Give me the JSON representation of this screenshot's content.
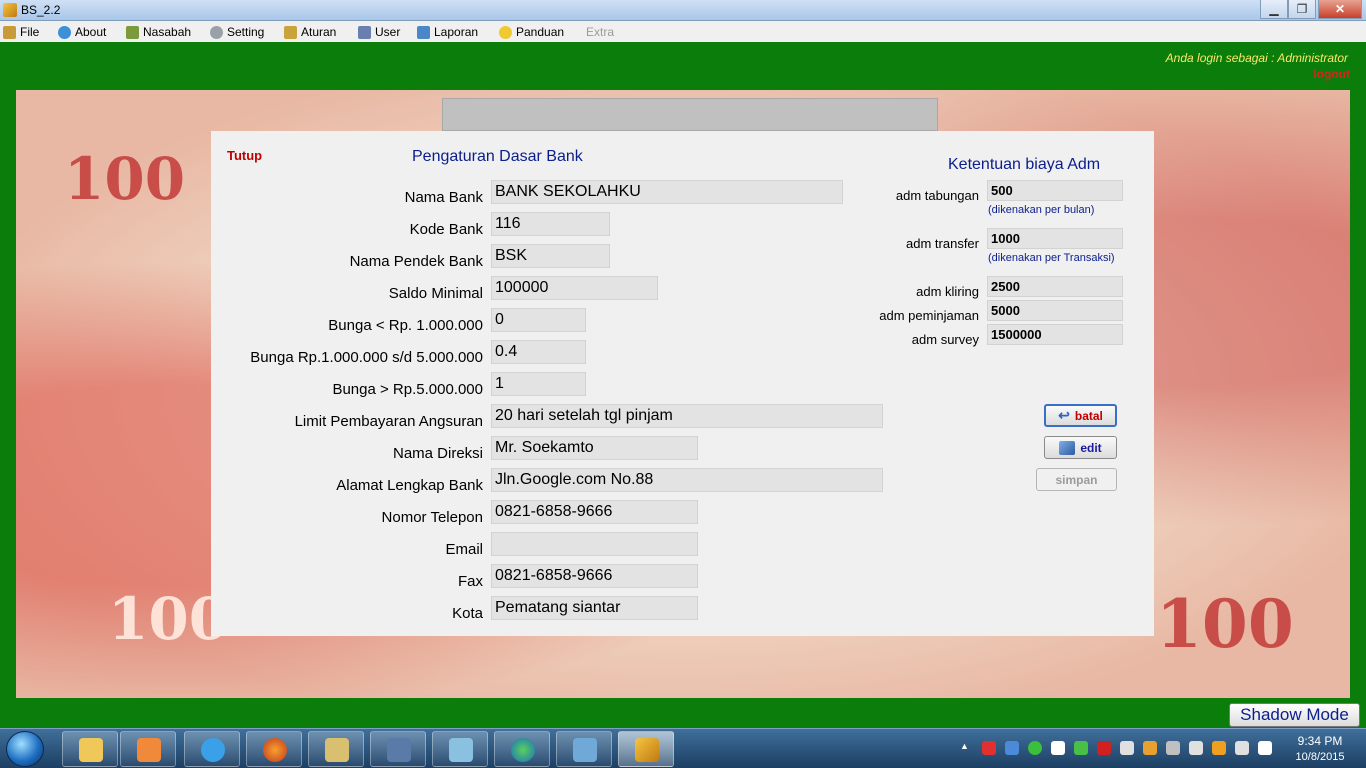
{
  "window": {
    "title": "BS_2.2",
    "min": "▁",
    "max": "❐",
    "close": "✕"
  },
  "menu": {
    "file": "File",
    "about": "About",
    "nasabah": "Nasabah",
    "setting": "Setting",
    "aturan": "Aturan",
    "user": "User",
    "laporan": "Laporan",
    "panduan": "Panduan",
    "extra": "Extra"
  },
  "session": {
    "login_text": "Anda login sebagai : Administrator",
    "logout": "logout"
  },
  "banknote": {
    "num1": "100",
    "num2": "100",
    "num3": "100"
  },
  "form": {
    "close_link": "Tutup",
    "title": "Pengaturan Dasar Bank",
    "fields": [
      {
        "label": "Nama Bank",
        "value": "BANK SEKOLAHKU"
      },
      {
        "label": "Kode Bank",
        "value": "116"
      },
      {
        "label": "Nama Pendek Bank",
        "value": "BSK"
      },
      {
        "label": "Saldo Minimal",
        "value": "100000"
      },
      {
        "label": "Bunga < Rp. 1.000.000",
        "value": "0"
      },
      {
        "label": "Bunga Rp.1.000.000 s/d 5.000.000",
        "value": "0.4"
      },
      {
        "label": "Bunga > Rp.5.000.000",
        "value": "1"
      },
      {
        "label": "Limit Pembayaran Angsuran",
        "value": "20 hari setelah tgl pinjam"
      },
      {
        "label": "Nama Direksi",
        "value": "Mr. Soekamto"
      },
      {
        "label": "Alamat Lengkap Bank",
        "value": "Jln.Google.com No.88"
      },
      {
        "label": "Nomor Telepon",
        "value": "0821-6858-9666"
      },
      {
        "label": "Email",
        "value": ""
      },
      {
        "label": "Fax",
        "value": "0821-6858-9666"
      },
      {
        "label": "Kota",
        "value": "Pematang siantar"
      }
    ]
  },
  "adm": {
    "title": "Ketentuan biaya Adm",
    "tabungan": {
      "label": "adm tabungan",
      "value": "500",
      "note": "(dikenakan per bulan)"
    },
    "transfer": {
      "label": "adm transfer",
      "value": "1000",
      "note": "(dikenakan per Transaksi)"
    },
    "kliring": {
      "label": "adm kliring",
      "value": "2500"
    },
    "peminjaman": {
      "label": "adm peminjaman",
      "value": "5000"
    },
    "survey": {
      "label": "adm survey",
      "value": "1500000"
    }
  },
  "buttons": {
    "batal": "batal",
    "edit": "edit",
    "simpan": "simpan"
  },
  "shadow_mode": "Shadow Mode",
  "clock": {
    "time": "9:34 PM",
    "date": "10/8/2015"
  },
  "colors": {
    "accent_green": "#0a7d0a",
    "title_blue": "#0a1e8c",
    "link_red": "#c00000"
  }
}
